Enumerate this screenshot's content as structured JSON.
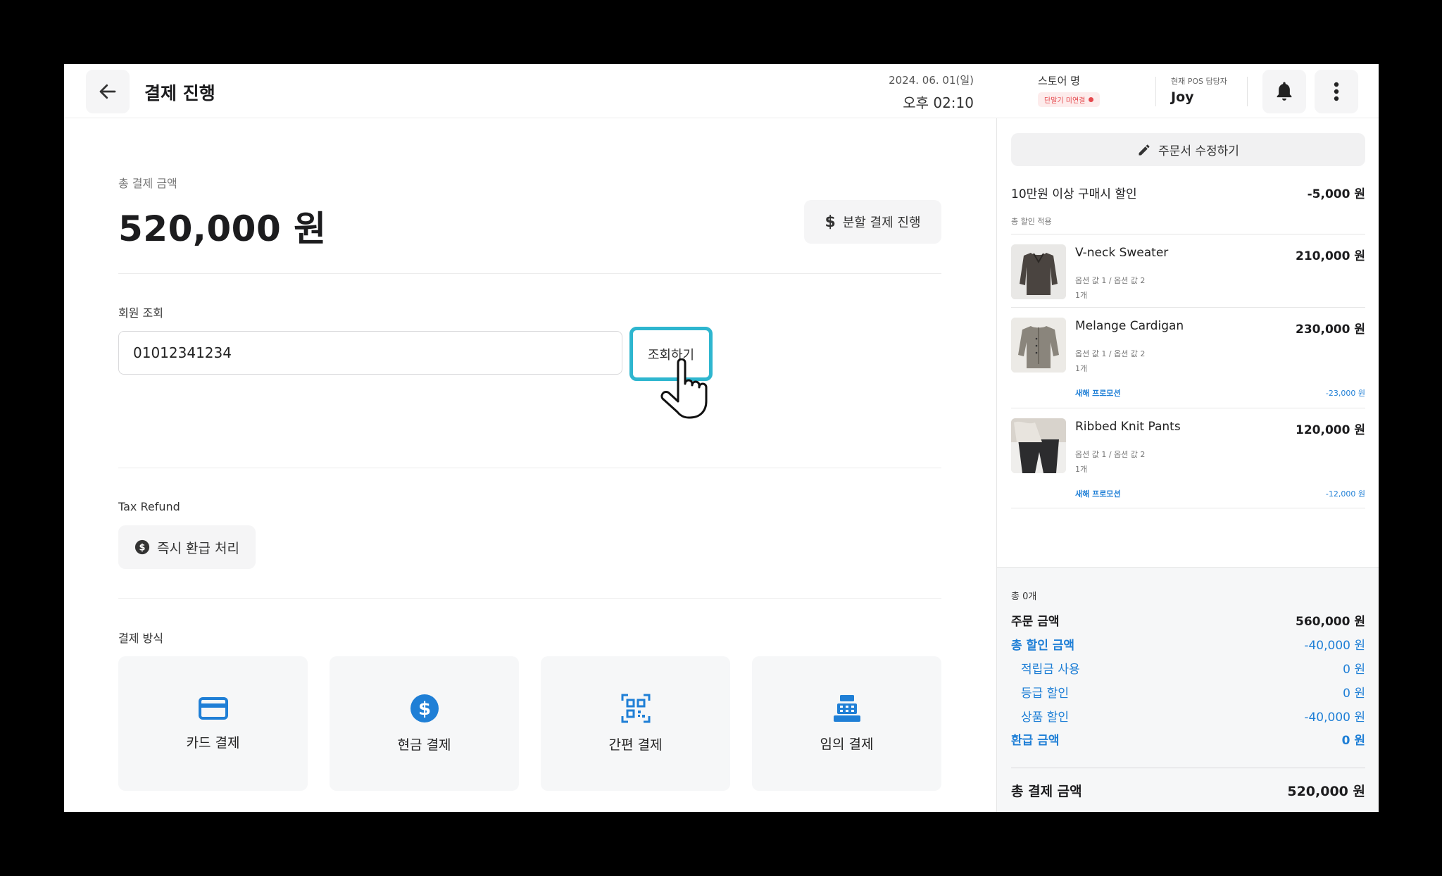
{
  "header": {
    "title": "결제 진행",
    "date": "2024. 06. 01(일)",
    "time": "오후 02:10",
    "store_name": "스토어 명",
    "store_status": "단말기 미연결",
    "staff_label": "현재 POS 담당자",
    "staff_name": "Joy"
  },
  "payment": {
    "total_label": "총 결제 금액",
    "total_amount": "520,000 원",
    "split_label": "분할 결제 진행"
  },
  "member": {
    "label": "회원 조회",
    "input_value": "01012341234",
    "search_label": "조회하기"
  },
  "tax_refund": {
    "label": "Tax Refund",
    "button_label": "즉시 환급 처리"
  },
  "methods": {
    "label": "결제 방식",
    "items": [
      {
        "label": "카드 결제",
        "icon": "credit-card-icon"
      },
      {
        "label": "현금 결제",
        "icon": "dollar-circle-icon"
      },
      {
        "label": "간편 결제",
        "icon": "qr-code-icon"
      },
      {
        "label": "임의 결제",
        "icon": "cash-register-icon"
      }
    ]
  },
  "order": {
    "edit_label": "주문서 수정하기",
    "discount_name": "10만원 이상 구매시 할인",
    "discount_value": "-5,000 원",
    "discount_sub": "총 할인 적용",
    "items": [
      {
        "name": "V-neck Sweater",
        "price": "210,000 원",
        "options": "옵션 값 1 / 옵션 값 2",
        "qty": "1개",
        "promo": "",
        "promo_value": ""
      },
      {
        "name": "Melange Cardigan",
        "price": "230,000 원",
        "options": "옵션 값 1 / 옵션 값 2",
        "qty": "1개",
        "promo": "새해 프로모션",
        "promo_value": "-23,000 원"
      },
      {
        "name": "Ribbed Knit Pants",
        "price": "120,000 원",
        "options": "옵션 값 1 / 옵션 값 2",
        "qty": "1개",
        "promo": "새해 프로모션",
        "promo_value": "-12,000 원"
      }
    ]
  },
  "summary": {
    "count": "총 0개",
    "order_amount_label": "주문 금액",
    "order_amount": "560,000 원",
    "discount_total_label": "총 할인 금액",
    "discount_total": "-40,000 원",
    "points_label": "적립금 사용",
    "points": "0 원",
    "grade_label": "등급 할인",
    "grade": "0 원",
    "product_label": "상품 할인",
    "product": "-40,000 원",
    "refund_label": "환급 금액",
    "refund": "0 원",
    "final_label": "총 결제 금액",
    "final": "520,000 원"
  },
  "colors": {
    "accent": "#1f7fd6",
    "highlight": "#2eb6cf",
    "error": "#e5484d"
  }
}
